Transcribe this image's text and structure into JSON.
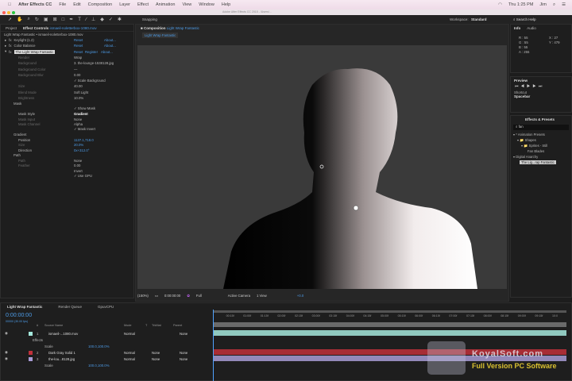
{
  "menubar": {
    "app": "After Effects CC",
    "items": [
      "File",
      "Edit",
      "Composition",
      "Layer",
      "Effect",
      "Animation",
      "View",
      "Window",
      "Help"
    ],
    "clock": "Thu 1:25 PM",
    "user": "Jim"
  },
  "titlebar": {
    "title": "Adobe After Effects CC 2015 - /Users/..."
  },
  "toolbar": {
    "snapping": "Snapping",
    "workspace_label": "Workspace:",
    "workspace": "Standard",
    "search_help": "Search Help"
  },
  "left_tabs": {
    "project": "Project",
    "effect_controls": "Effect Controls",
    "effect_controls_file": "ismaeil-noletterbox-1080.mov"
  },
  "effect_controls": {
    "header": "Light Wrap Fantastic • ismaeil-noletterbox-1080.mov",
    "effects": [
      {
        "name": "Keylight (1.2)",
        "reset": "Reset",
        "about": "About..."
      },
      {
        "name": "Color Balance",
        "reset": "Reset",
        "about": "About..."
      },
      {
        "name": "The Light Wrap Fantastic",
        "reset": "Reset",
        "register": "Register",
        "about": "About..."
      }
    ],
    "props": [
      {
        "label": "Render",
        "value": "Wrap"
      },
      {
        "label": "Background",
        "value": "3. the-lounge-1538128.jpg"
      },
      {
        "label": "Background Color",
        "value": "—"
      },
      {
        "label": "Background Blur",
        "value": "0.00"
      },
      {
        "label": "",
        "value": "Scale Background"
      },
      {
        "label": "Size",
        "value": "40.00"
      },
      {
        "label": "Blend Mode",
        "value": "Soft Light"
      },
      {
        "label": "Brightness",
        "value": "10.0%"
      },
      {
        "label": "Mask",
        "value": ""
      },
      {
        "label": "",
        "value": "Show Mask"
      },
      {
        "label": "Mask Style",
        "value": "Gradient"
      },
      {
        "label": "Mask Input",
        "value": "None"
      },
      {
        "label": "Mask Channel",
        "value": "Alpha"
      },
      {
        "label": "",
        "value": "Mask Invert"
      },
      {
        "label": "Gradient",
        "value": ""
      },
      {
        "label": "Position",
        "value": "1137.1,718.0"
      },
      {
        "label": "Size",
        "value": "20.0%"
      },
      {
        "label": "Direction",
        "value": "0x+312.0°"
      },
      {
        "label": "Path",
        "value": ""
      },
      {
        "label": "Path",
        "value": "None"
      },
      {
        "label": "Feather",
        "value": "0.00"
      },
      {
        "label": "",
        "value": "Invert"
      },
      {
        "label": "",
        "value": "Use GPU"
      }
    ]
  },
  "composition": {
    "tab_label": "Composition",
    "comp_name": "Light Wrap Fantastic",
    "crumb": "Light Wrap Fantastic",
    "zoom": "(150%)",
    "timecode": "0:00:00:00",
    "resolution": "Full",
    "camera": "Active Camera",
    "views": "1 View",
    "exposure": "+0.0"
  },
  "info": {
    "tab": "Info",
    "audio_tab": "Audio",
    "r": "R : 55",
    "g": "G : 55",
    "b": "B : 55",
    "a": "A : 255",
    "x": "X : 27",
    "y": "Y : 479"
  },
  "preview": {
    "tab": "Preview",
    "shortcut_label": "Shortcut",
    "shortcut": "Spacebar"
  },
  "effects_presets": {
    "tab": "Effects & Presets",
    "search": "fan",
    "tree": [
      "* Animation Presets",
      "Shapes",
      "Sprites - Still",
      "Fan Blades",
      "Digital Anarchy",
      "The Lig...rap Fantastic"
    ]
  },
  "timeline": {
    "tabs": [
      "Light Wrap Fantastic",
      "Render Queue",
      "GpuvCPU"
    ],
    "timecode": "0:00:00:00",
    "fps": "00000 (30.00 fps)",
    "columns": [
      "#",
      "Source Name",
      "Mode",
      "T",
      "TrkMat",
      "Parent"
    ],
    "layers": [
      {
        "num": "1",
        "name": "ismaeil-...1080.mov",
        "mode": "Normal",
        "trkmat": "",
        "parent": "None",
        "color": "#a4e8dc"
      },
      {
        "num": "",
        "name": "Effects",
        "sub": true
      },
      {
        "num": "",
        "name": "Scale",
        "value": "100.0,100.0%",
        "sub": true
      },
      {
        "num": "2",
        "name": "Dark Gray Solid 1",
        "mode": "Normal",
        "trkmat": "None",
        "parent": "None",
        "color": "#c0303a"
      },
      {
        "num": "3",
        "name": "the-lou...8128.jpg",
        "mode": "Normal",
        "trkmat": "None",
        "parent": "None",
        "color": "#a89cd6"
      },
      {
        "num": "",
        "name": "Scale",
        "value": "100.0,100.0%",
        "sub": true
      }
    ],
    "ruler": [
      "00:15f",
      "01:00f",
      "01:15f",
      "02:00f",
      "02:15f",
      "03:00f",
      "03:15f",
      "04:00f",
      "04:15f",
      "05:00f",
      "05:15f",
      "06:00f",
      "06:15f",
      "07:00f",
      "07:15f",
      "08:00f",
      "08:15f",
      "09:00f",
      "09:15f",
      "10:0"
    ]
  },
  "watermark": {
    "site": "KoyalSoft.com",
    "tagline": "Full Version PC Software"
  }
}
